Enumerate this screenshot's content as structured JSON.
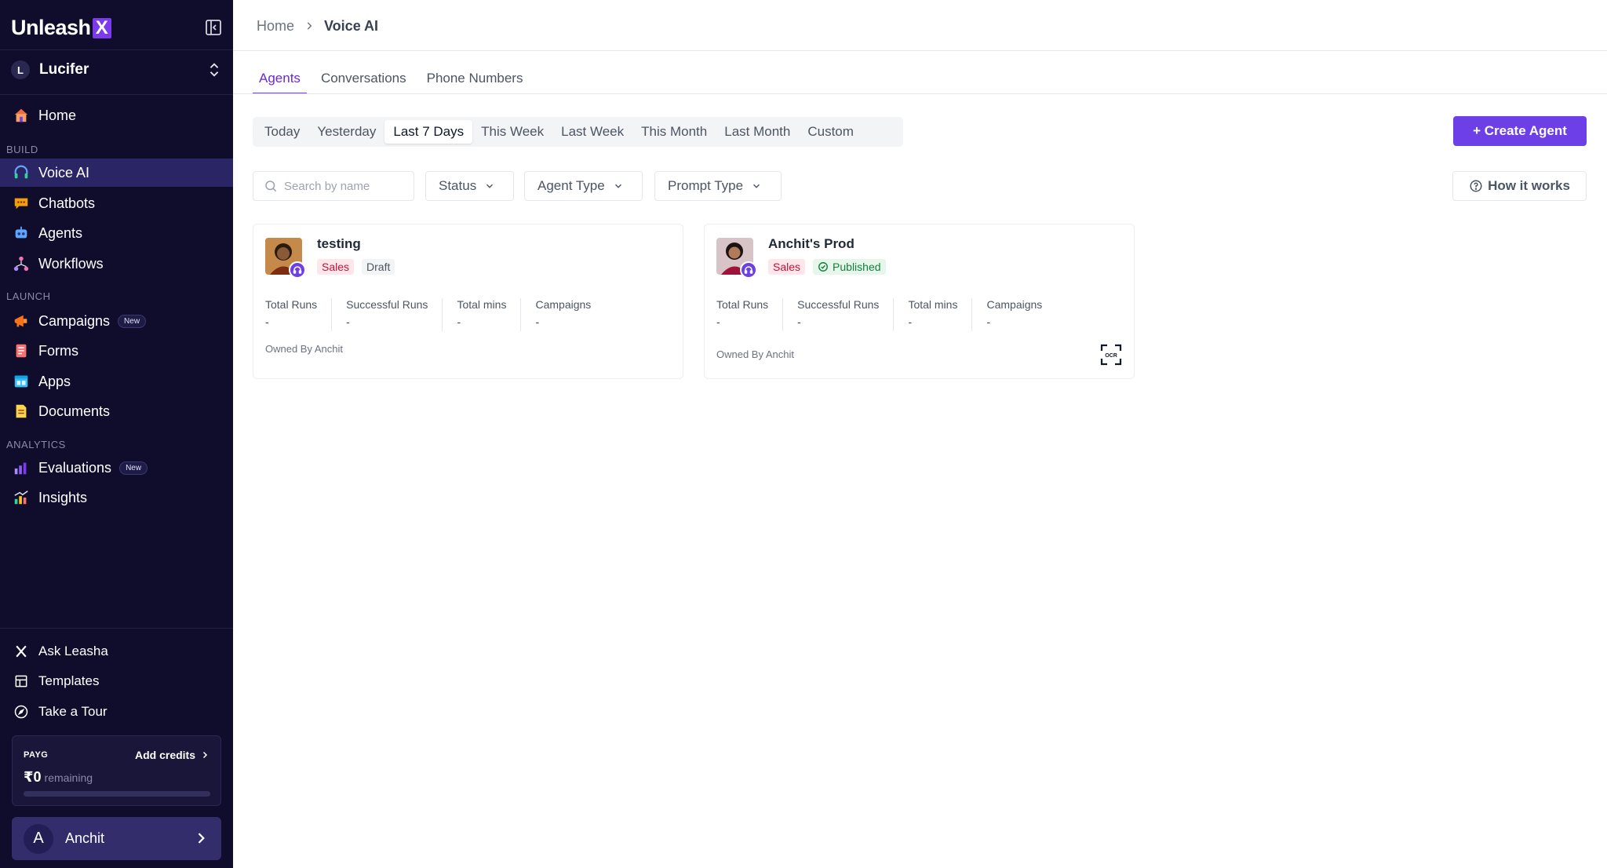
{
  "sidebar": {
    "logo_text": "Unleash",
    "logo_mark": "X",
    "org": {
      "initial": "L",
      "name": "Lucifer"
    },
    "nav_top": [
      {
        "label": "Home",
        "icon": "house-icon"
      }
    ],
    "sections": [
      {
        "label": "BUILD",
        "items": [
          {
            "label": "Voice AI",
            "icon": "headset-icon",
            "active": true
          },
          {
            "label": "Chatbots",
            "icon": "chat-bubble-icon"
          },
          {
            "label": "Agents",
            "icon": "robot-icon"
          },
          {
            "label": "Workflows",
            "icon": "workflow-icon"
          }
        ]
      },
      {
        "label": "LAUNCH",
        "items": [
          {
            "label": "Campaigns",
            "icon": "megaphone-icon",
            "badge": "New"
          },
          {
            "label": "Forms",
            "icon": "form-icon"
          },
          {
            "label": "Apps",
            "icon": "apps-icon"
          },
          {
            "label": "Documents",
            "icon": "document-icon"
          }
        ]
      },
      {
        "label": "ANALYTICS",
        "items": [
          {
            "label": "Evaluations",
            "icon": "bar-chart-icon",
            "badge": "New"
          },
          {
            "label": "Insights",
            "icon": "insights-icon"
          }
        ]
      }
    ],
    "bottom": [
      {
        "label": "Ask Leasha",
        "icon": "x-icon"
      },
      {
        "label": "Templates",
        "icon": "templates-icon"
      },
      {
        "label": "Take a Tour",
        "icon": "compass-icon"
      }
    ],
    "credits": {
      "plan": "PAYG",
      "add_label": "Add credits",
      "amount": "₹0",
      "remaining_label": "remaining",
      "progress": 0.0
    },
    "user": {
      "initial": "A",
      "name": "Anchit"
    }
  },
  "breadcrumb": {
    "home": "Home",
    "current": "Voice AI"
  },
  "tabs": [
    {
      "label": "Agents",
      "active": true
    },
    {
      "label": "Conversations"
    },
    {
      "label": "Phone Numbers"
    }
  ],
  "date_filters": [
    {
      "label": "Today"
    },
    {
      "label": "Yesterday"
    },
    {
      "label": "Last 7 Days",
      "active": true
    },
    {
      "label": "This Week"
    },
    {
      "label": "Last Week"
    },
    {
      "label": "This Month"
    },
    {
      "label": "Last Month"
    },
    {
      "label": "Custom"
    }
  ],
  "create_button": "+ Create Agent",
  "search": {
    "placeholder": "Search by name",
    "value": ""
  },
  "filters": {
    "status": "Status",
    "agent_type": "Agent Type",
    "prompt_type": "Prompt Type"
  },
  "how_it_works": "How it works",
  "metric_labels": {
    "total_runs": "Total Runs",
    "successful_runs": "Successful Runs",
    "total_mins": "Total mins",
    "campaigns": "Campaigns"
  },
  "cards": [
    {
      "name": "testing",
      "tag": "Sales",
      "status": "Draft",
      "total_runs": "-",
      "successful_runs": "-",
      "total_mins": "-",
      "campaigns": "-",
      "owner": "Owned By Anchit"
    },
    {
      "name": "Anchit's Prod",
      "tag": "Sales",
      "status": "Published",
      "total_runs": "-",
      "successful_runs": "-",
      "total_mins": "-",
      "campaigns": "-",
      "owner": "Owned By Anchit"
    }
  ],
  "colors": {
    "sidebar_bg": "#0f0d2b",
    "accent": "#6d3fe6",
    "active_nav": "#2a2564"
  }
}
